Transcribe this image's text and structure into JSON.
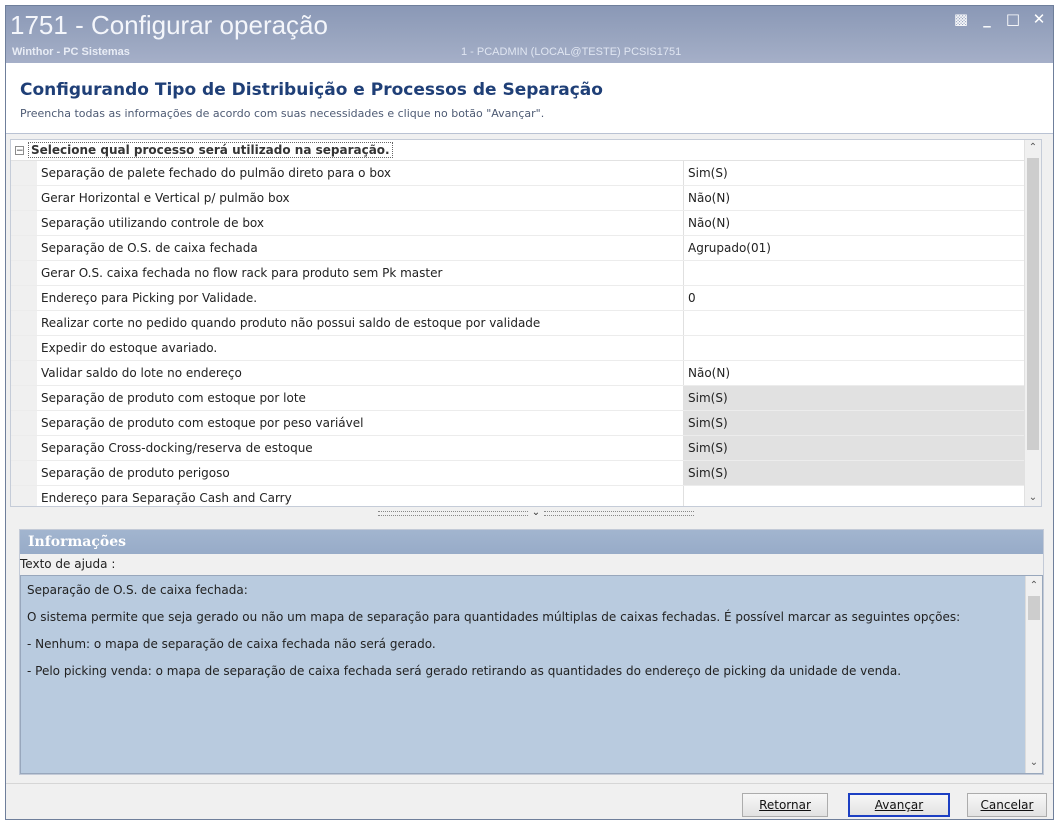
{
  "window": {
    "title": "1751 - Configurar operação",
    "subtitle": "Winthor - PC Sistemas",
    "session": "1 - PCADMIN (LOCAL@TESTE)   PCSIS1751",
    "controls": [
      "restore-icon",
      "minimize-icon",
      "maximize-icon",
      "close-icon"
    ]
  },
  "header": {
    "heading": "Configurando Tipo de Distribuição e Processos de Separação",
    "description": "Preencha todas as informações de acordo com suas necessidades e clique no botão \"Avançar\"."
  },
  "grid": {
    "category": "Selecione qual processo será utilizado na separação.",
    "rows": [
      {
        "name": "Separação de palete fechado do pulmão direto para o box",
        "value": "Sim(S)"
      },
      {
        "name": "Gerar Horizontal e Vertical p/ pulmão box",
        "value": "Não(N)"
      },
      {
        "name": "Separação utilizando controle de box",
        "value": "Não(N)"
      },
      {
        "name": "Separação de O.S. de caixa fechada",
        "value": "Agrupado(01)"
      },
      {
        "name": "Gerar O.S. caixa fechada no flow rack para produto sem Pk master",
        "value": ""
      },
      {
        "name": "Endereço para Picking por Validade.",
        "value": "0"
      },
      {
        "name": "Realizar corte no pedido quando produto não possui saldo de estoque por validade",
        "value": ""
      },
      {
        "name": "Expedir do estoque avariado.",
        "value": ""
      },
      {
        "name": "Validar saldo do lote no endereço",
        "value": "Não(N)"
      },
      {
        "name": "Separação de produto com estoque por lote",
        "value": "Sim(S)"
      },
      {
        "name": "Separação de produto com estoque por peso variável",
        "value": "Sim(S)"
      },
      {
        "name": "Separação Cross-docking/reserva de estoque",
        "value": "Sim(S)"
      },
      {
        "name": "Separação de produto perigoso",
        "value": "Sim(S)"
      },
      {
        "name": "Endereço para Separação Cash and Carry",
        "value": ""
      }
    ]
  },
  "info": {
    "title": "Informações",
    "help_label": "Texto de ajuda :",
    "paragraphs": [
      "Separação de O.S. de caixa fechada:",
      "O sistema permite que seja gerado ou não um mapa de separação para quantidades múltiplas de caixas fechadas. É possível marcar as seguintes opções:",
      "- Nenhum: o mapa de separação de caixa fechada não será gerado.",
      "- Pelo picking venda: o mapa de separação de caixa fechada será gerado retirando as quantidades do endereço de picking da unidade de venda."
    ]
  },
  "buttons": {
    "back": "Retornar",
    "next": "Avançar",
    "cancel": "Cancelar"
  }
}
